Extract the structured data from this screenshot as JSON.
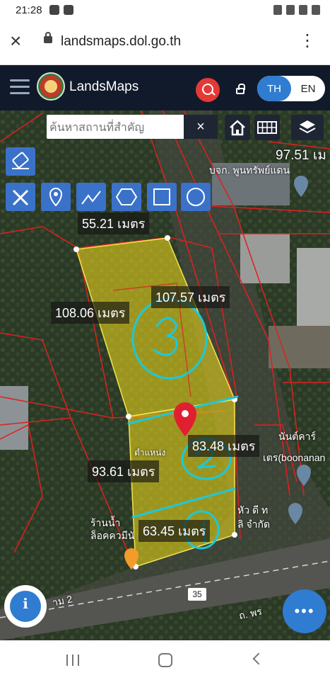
{
  "status": {
    "time": "21:28"
  },
  "browser": {
    "url": "landsmaps.dol.go.th"
  },
  "app": {
    "brand": "LandsMaps",
    "lang_th": "TH",
    "lang_en": "EN"
  },
  "search": {
    "placeholder": "ค้นหาสถานที่สำคัญ",
    "clear": "×"
  },
  "map": {
    "measure_top": "55.21 เมตร",
    "measure_left_upper": "108.06 เมตร",
    "measure_right_upper": "107.57 เมตร",
    "measure_left_lower": "93.61 เมตร",
    "measure_right_lower": "83.48 เมตร",
    "measure_bottom": "63.45 เมตร",
    "label_97": "97.51 เม",
    "label_company": "บจก. พูนทรัพย์แดน",
    "label_position": "ตำแหน่ง",
    "label_boonanan": "เตร(boonanan",
    "label_nant": "นันต์คาร์",
    "label_store_1": "ร้านน้ำ",
    "label_store_2": "ล็อคควมีนั",
    "label_road_left": "าม 2",
    "label_road_right": "ถ. พร",
    "label_company_2": "หัว ดี ท",
    "label_company_3": "ลิ จำกัด",
    "road_number": "35",
    "annotation_1": "1",
    "annotation_2": "2",
    "annotation_3": "3"
  },
  "colors": {
    "accent": "#2f7cd1",
    "parcel": "#e6d21c",
    "boundary": "#e02020",
    "annotation": "#1ec8d8"
  }
}
